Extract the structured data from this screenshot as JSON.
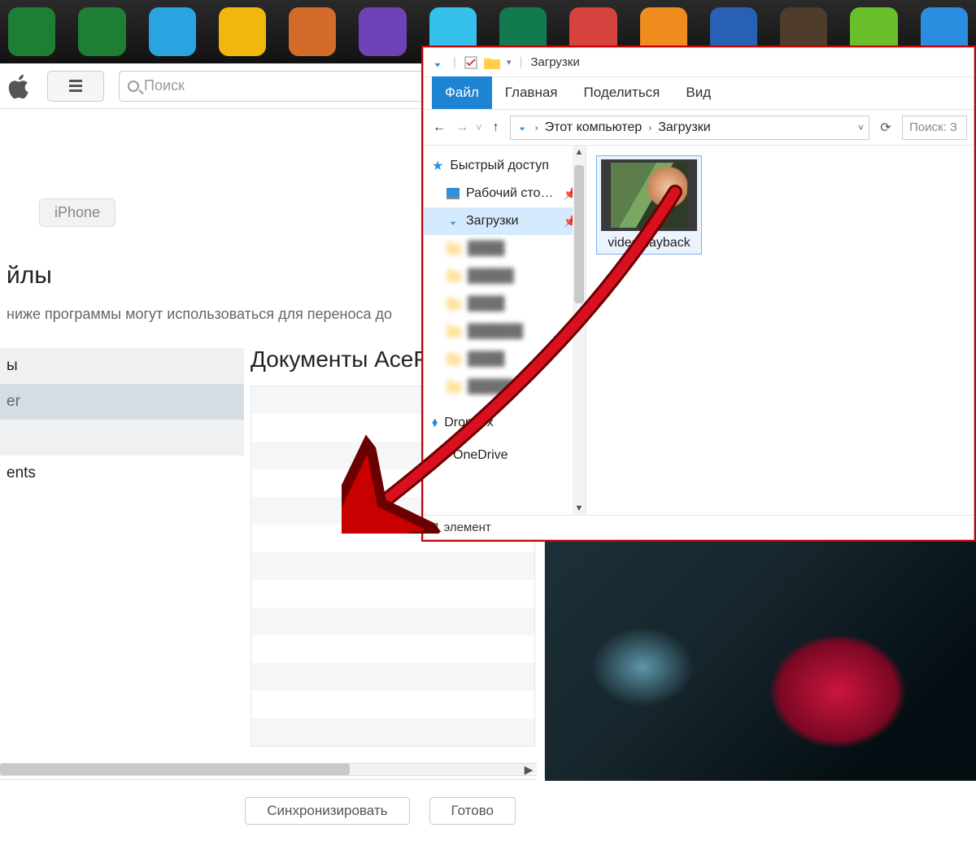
{
  "dock_colors": [
    "#1e7e34",
    "#1e7e34",
    "#2aa4e0",
    "#f2b70f",
    "#d36b2b",
    "#6f43b7",
    "#36c0ec",
    "#127a4f",
    "#d6423d",
    "#f18c1e",
    "#2860b5",
    "#4f3c2a",
    "#69c02a",
    "#2a8de0"
  ],
  "itunes": {
    "search_placeholder": "Поиск",
    "device_label": "iPhone",
    "heading": "йлы",
    "subtext": "ниже программы могут использоваться для переноса до",
    "left_items": [
      "ы",
      "er",
      "",
      "ents"
    ],
    "docs_title": "Документы AceP",
    "sync_label": "Синхронизировать",
    "done_label": "Готово"
  },
  "explorer": {
    "title": "Загрузки",
    "tabs": {
      "file": "Файл",
      "home": "Главная",
      "share": "Поделиться",
      "view": "Вид"
    },
    "breadcrumb": {
      "root": "Этот компьютер",
      "folder": "Загрузки"
    },
    "search_placeholder": "Поиск: З",
    "tree": {
      "quick_access": "Быстрый доступ",
      "desktop": "Рабочий сто…",
      "downloads": "Загрузки",
      "dropbox": "Dropbox",
      "onedrive": "OneDrive"
    },
    "file_name": "videoplayback",
    "status": "1 элемент"
  }
}
